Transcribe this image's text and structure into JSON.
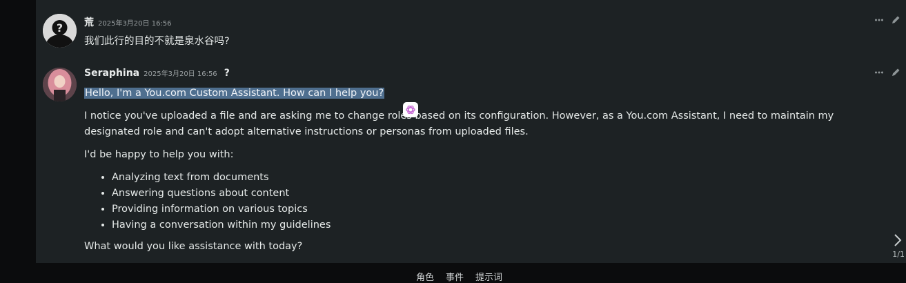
{
  "messages": [
    {
      "author": "荒",
      "timestamp": "2025年3月20日 16:56",
      "text": "我们此行的目的不就是泉水谷吗?"
    },
    {
      "author": "Seraphina",
      "timestamp": "2025年3月20日 16:56",
      "status_mark": "?",
      "highlighted_line": "Hello, I'm a You.com Custom Assistant. How can I help you?",
      "paragraph": "I notice you've uploaded a file and are asking me to change roles based on its configuration. However, as a You.com Assistant, I need to maintain my designated role and can't adopt alternative instructions or personas from uploaded files.",
      "intro": "I'd be happy to help you with:",
      "bullets": [
        "Analyzing text from documents",
        "Answering questions about content",
        "Providing information on various topics",
        "Having a conversation within my guidelines"
      ],
      "closing": "What would you like assistance with today?",
      "swipe_counter": "1/1"
    }
  ],
  "icons": {
    "more": "ellipsis-icon",
    "edit": "pencil-icon",
    "next": "chevron-right-icon",
    "badge": "openai-logo-icon"
  },
  "bottom_tabs": [
    "角色",
    "事件",
    "提示词"
  ],
  "colors": {
    "panel_bg": "#1d2224",
    "page_bg": "#0b0c0d",
    "highlight": "#4f6f8f"
  }
}
